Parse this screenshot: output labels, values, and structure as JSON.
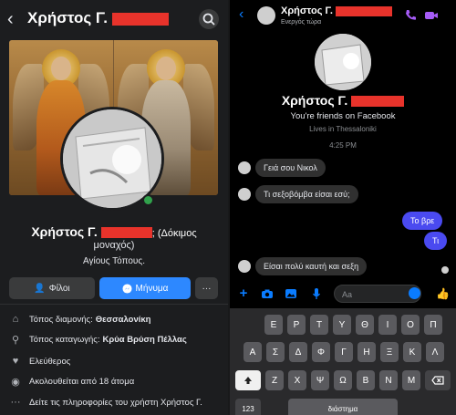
{
  "profile": {
    "title_name": "Χρήστος Γ.",
    "display_name": "Χρήστος Γ.",
    "name_suffix": "; (Δόκιμος",
    "name_suffix2": "μοναχός)",
    "about": "Αγίους Τόπους.",
    "friends_button": "Φίλοι",
    "message_button": "Μήνυμα",
    "more_button": "···",
    "info": [
      {
        "icon": "home-icon",
        "label": "Τόπος διαμονής:",
        "value": "Θεσσαλονίκη"
      },
      {
        "icon": "location-pin-icon",
        "label": "Τόπος καταγωγής:",
        "value": "Κρύα Βρύση Πέλλας"
      },
      {
        "icon": "heart-icon",
        "label": "Ελεύθερος",
        "value": ""
      },
      {
        "icon": "rss-icon",
        "label": "Ακολουθείται από 18 άτομα",
        "value": ""
      },
      {
        "icon": "ellipsis-icon",
        "label": "Δείτε τις πληροφορίες του χρήστη Χρήστος Γ.",
        "value": ""
      }
    ]
  },
  "messenger": {
    "header_name": "Χρήστος Γ.",
    "header_status": "Ενεργός τώρα",
    "contact_name": "Χρήστος Γ.",
    "friends_text": "You're friends on Facebook",
    "lives_text": "Lives in Thessaloniki",
    "timestamp": "4:25 PM",
    "messages": [
      {
        "dir": "in",
        "text": "Γειά σου Νικολ"
      },
      {
        "dir": "in",
        "text": "Τι σεξοβόμβα είσαι εσύ;"
      },
      {
        "dir": "out",
        "text": "Το βρε"
      },
      {
        "dir": "out",
        "text": "Τι"
      },
      {
        "dir": "in",
        "text": "Είσαι πολύ καυτή και σεξη"
      }
    ],
    "input_placeholder": "Aa",
    "accent": "#0a7cff"
  },
  "keyboard": {
    "row1": [
      "Ε",
      "Ρ",
      "Τ",
      "Υ",
      "Θ",
      "Ι",
      "Ο",
      "Π"
    ],
    "row2": [
      "Α",
      "Σ",
      "Δ",
      "Φ",
      "Γ",
      "Η",
      "Ξ",
      "Κ",
      "Λ"
    ],
    "row3": [
      "Ζ",
      "Χ",
      "Ψ",
      "Ω",
      "Β",
      "Ν",
      "Μ"
    ],
    "numbers_key": "123",
    "space_key": "διάστημα"
  },
  "colors": {
    "redaction": "#e8332b",
    "fb_blue": "#2d88ff",
    "online": "#31a24c",
    "outgoing_bubble": "#4a4af0"
  }
}
